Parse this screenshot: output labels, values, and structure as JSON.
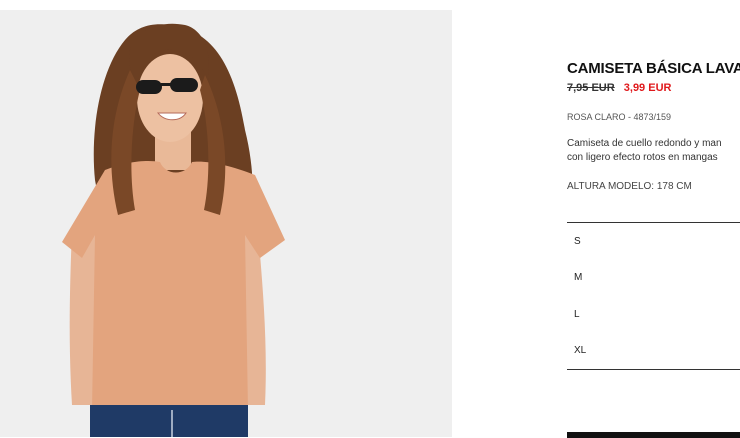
{
  "product": {
    "title": "CAMISETA BÁSICA LAVADA",
    "old_price": "7,95 EUR",
    "new_price": "3,99 EUR",
    "color_ref": "ROSA CLARO - 4873/159",
    "description_line1": "Camiseta de cuello redondo y man",
    "description_line2": "con ligero efecto rotos en mangas",
    "model_height": "ALTURA MODELO: 178 CM"
  },
  "sizes": [
    "S",
    "M",
    "L",
    "XL"
  ],
  "colors": {
    "sale_price": "#e0191c",
    "tshirt": "#e3a47e",
    "photo_background": "#eeeeee"
  }
}
